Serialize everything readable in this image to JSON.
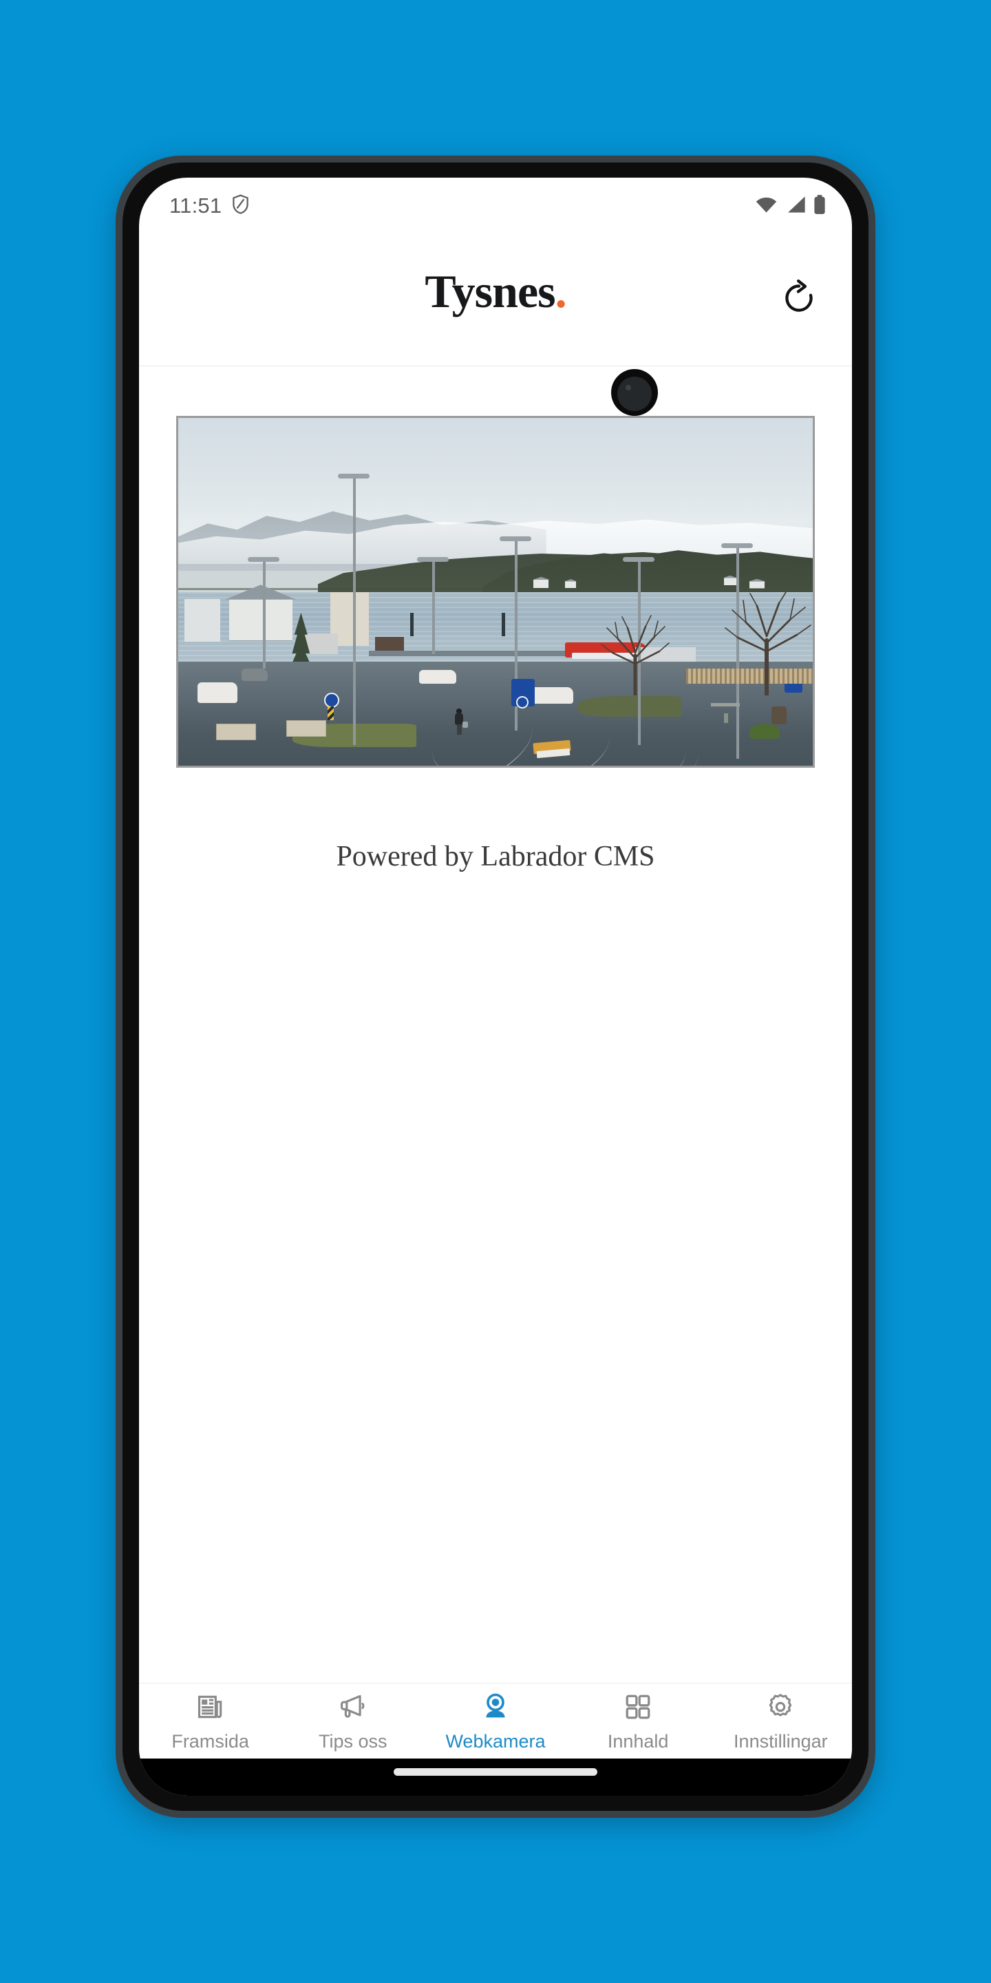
{
  "device": {
    "status_bar": {
      "clock": "11:51",
      "icons": [
        "shield-icon",
        "wifi-icon",
        "cellular-signal-icon",
        "battery-icon"
      ]
    },
    "gesture_bar": true
  },
  "header": {
    "logo_text": "Tysnes",
    "logo_dot": ".",
    "logo_dot_color": "#F0662B",
    "refresh_icon": "refresh-icon"
  },
  "main": {
    "webcam": {
      "alt": "Tysnes harbour webcam live view",
      "scene_description": "Coastal Norwegian village webcam: fjord water, snow capped mountains, forested hillside with white houses, wet curved roads, street lamps, a person walking with a bucket, parked white cars, red boat, planters and bare trees"
    },
    "credit_text": "Powered by Labrador CMS"
  },
  "bottom_nav": {
    "active_index": 2,
    "active_color": "#1D8BC8",
    "inactive_color": "#8a8a8a",
    "items": [
      {
        "label": "Framsida",
        "icon": "newspaper-icon"
      },
      {
        "label": "Tips oss",
        "icon": "megaphone-icon"
      },
      {
        "label": "Webkamera",
        "icon": "webcam-icon"
      },
      {
        "label": "Innhald",
        "icon": "grid-icon"
      },
      {
        "label": "Innstillingar",
        "icon": "gear-icon"
      }
    ]
  },
  "theme": {
    "page_background": "#0593D4",
    "screen_background": "#FFFFFF",
    "frame_color": "#3b4044"
  }
}
